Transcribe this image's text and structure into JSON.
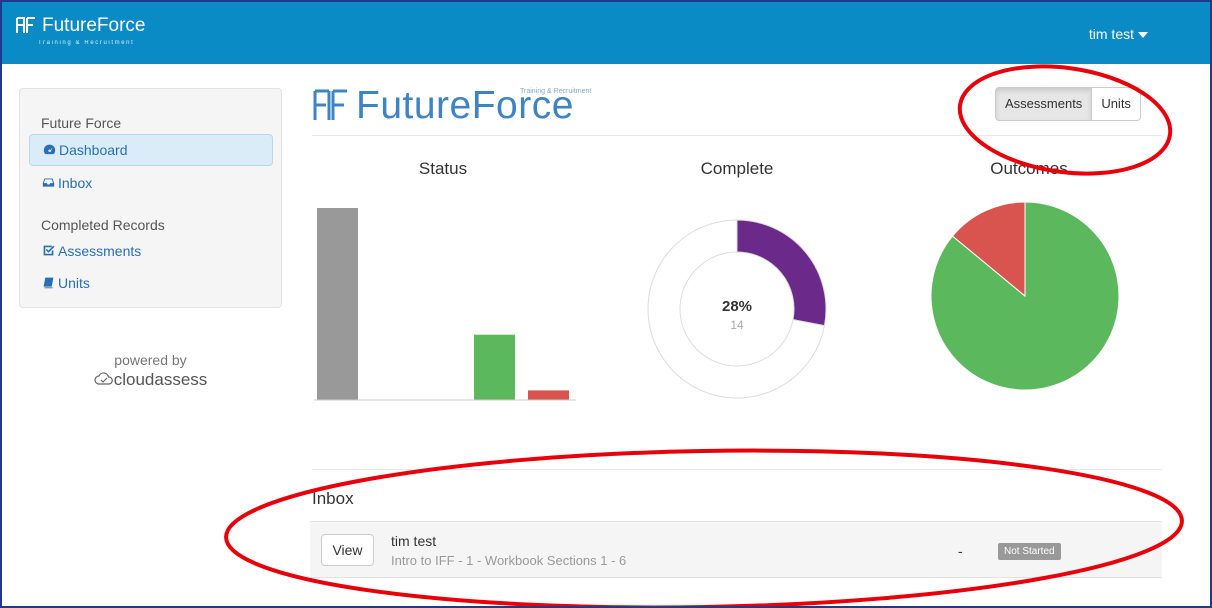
{
  "navbar": {
    "brand": "FutureForce",
    "brand_tagline": "Training & Recruitment",
    "user": "tim test",
    "bg_color": "#0a8bc6"
  },
  "sidebar": {
    "section1_heading": "Future Force",
    "items1": [
      {
        "label": "Dashboard",
        "icon": "dashboard-icon",
        "active": true
      },
      {
        "label": "Inbox",
        "icon": "inbox-icon",
        "active": false
      }
    ],
    "section2_heading": "Completed Records",
    "items2": [
      {
        "label": "Assessments",
        "icon": "checkbox-icon"
      },
      {
        "label": "Units",
        "icon": "book-icon"
      }
    ],
    "powered_by": "powered by",
    "powered_brand": "cloudassess"
  },
  "main": {
    "logo_name": "FutureForce",
    "logo_tagline": "Training & Recruitment",
    "toggle": {
      "assessments": "Assessments",
      "units": "Units",
      "active": "Assessments"
    }
  },
  "chart_data": [
    {
      "type": "bar",
      "title": "Status",
      "categories": [
        "",
        "",
        "",
        ""
      ],
      "values": [
        50,
        0,
        17,
        2.5
      ],
      "colors": [
        "#999999",
        "#999999",
        "#5cb85c",
        "#d9534f"
      ]
    },
    {
      "type": "pie",
      "title": "Complete",
      "center_text": "28%",
      "center_subtext": "14",
      "slices": [
        {
          "value": 28,
          "color": "#6b2a8a"
        },
        {
          "value": 72,
          "color": "#ffffff"
        }
      ]
    },
    {
      "type": "pie",
      "title": "Outcomes",
      "slices": [
        {
          "value": 86,
          "color": "#5cb85c"
        },
        {
          "value": 14,
          "color": "#d9534f"
        }
      ]
    }
  ],
  "inbox": {
    "title": "Inbox",
    "rows": [
      {
        "action": "View",
        "name": "tim test",
        "detail": "Intro to IFF - 1 - Workbook Sections 1 - 6",
        "dash": "-",
        "status": "Not Started"
      }
    ]
  },
  "annotation_color": "#e8000b"
}
